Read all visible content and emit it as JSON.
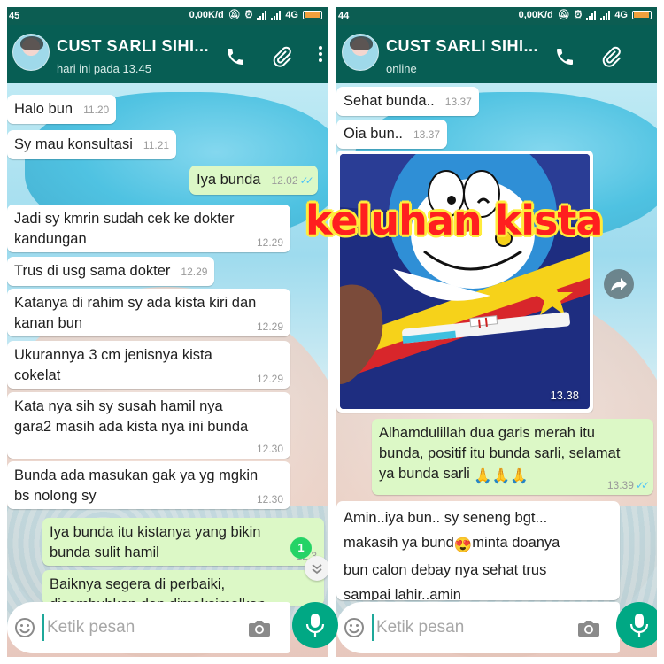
{
  "left": {
    "statusbar": {
      "left_text": "45",
      "net_speed": "0,00K/d",
      "network": "4G"
    },
    "header": {
      "name": "CUST SARLI SIHI...",
      "status": "hari ini pada 13.45"
    },
    "messages": [
      {
        "dir": "in",
        "text": "Halo bun",
        "time": "11.20"
      },
      {
        "dir": "in",
        "text": "Sy mau konsultasi",
        "time": "11.21"
      },
      {
        "dir": "out",
        "text": "Iya bunda",
        "time": "12.02"
      },
      {
        "dir": "in",
        "text": "Jadi sy kmrin sudah cek ke dokter\nkandungan",
        "time": "12.29"
      },
      {
        "dir": "in",
        "text": "Trus di usg sama dokter",
        "time": "12.29"
      },
      {
        "dir": "in",
        "text": "Katanya di rahim sy ada kista kiri dan\nkanan bun",
        "time": "12.29"
      },
      {
        "dir": "in",
        "text": "Ukurannya 3 cm jenisnya kista\ncokelat",
        "time": "12.29"
      },
      {
        "dir": "in",
        "text": "Kata nya sih sy susah hamil nya\ngara2 masih ada kista nya ini bunda",
        "time": "12.30"
      },
      {
        "dir": "in",
        "text": "Bunda ada masukan gak ya yg mgkin\nbs nolong sy",
        "time": "12.30"
      },
      {
        "dir": "out",
        "text": "Iya bunda itu kistanya yang bikin\nbunda sulit hamil",
        "time": "12.3"
      },
      {
        "dir": "out",
        "text": "Baiknya segera di perbaiki,\ndisembuhkan dan dimaksimalkan",
        "time": ""
      }
    ],
    "unread_count": "1",
    "input_placeholder": "Ketik pesan"
  },
  "right": {
    "statusbar": {
      "left_text": "44",
      "net_speed": "0,00K/d",
      "network": "4G"
    },
    "header": {
      "name": "CUST SARLI SIHI...",
      "status": "online"
    },
    "messages": [
      {
        "dir": "in",
        "text": "Sehat bunda..",
        "time": "13.37"
      },
      {
        "dir": "in",
        "text": "Oia bun..",
        "time": "13.37"
      },
      {
        "dir": "out",
        "text": "Alhamdulillah dua garis merah itu\nbunda, positif itu bunda sarli, selamat\nya bunda sarli ",
        "emoji": "🙏🙏🙏",
        "time": "13.39"
      },
      {
        "dir": "in",
        "text_a": "Amin..iya bun.. sy seneng bgt...\nmakasih ya bund",
        "emoji": "😍",
        "text_b": "minta doanya\nbun calon debay nya sehat trus\nsampai lahir..amin",
        "time": ""
      }
    ],
    "image_time": "13.38",
    "overlay_caption": "keluhan kista",
    "input_placeholder": "Ketik pesan"
  },
  "colors": {
    "header": "#075e54",
    "statusbar": "#0c5d52",
    "bubble_in": "#ffffff",
    "bubble_out": "#dcf8c6",
    "read_ticks": "#4fc3f7",
    "mic_button": "#00a884",
    "caption_fill": "#ff1f1f",
    "caption_outline": "#ffeb3b"
  },
  "icons": [
    "phone-icon",
    "attach-clip-icon",
    "more-options-icon",
    "emoji-icon",
    "camera-icon",
    "mic-icon",
    "share-forward-icon",
    "scroll-down-icon",
    "alarm-icon",
    "mute-icon"
  ]
}
